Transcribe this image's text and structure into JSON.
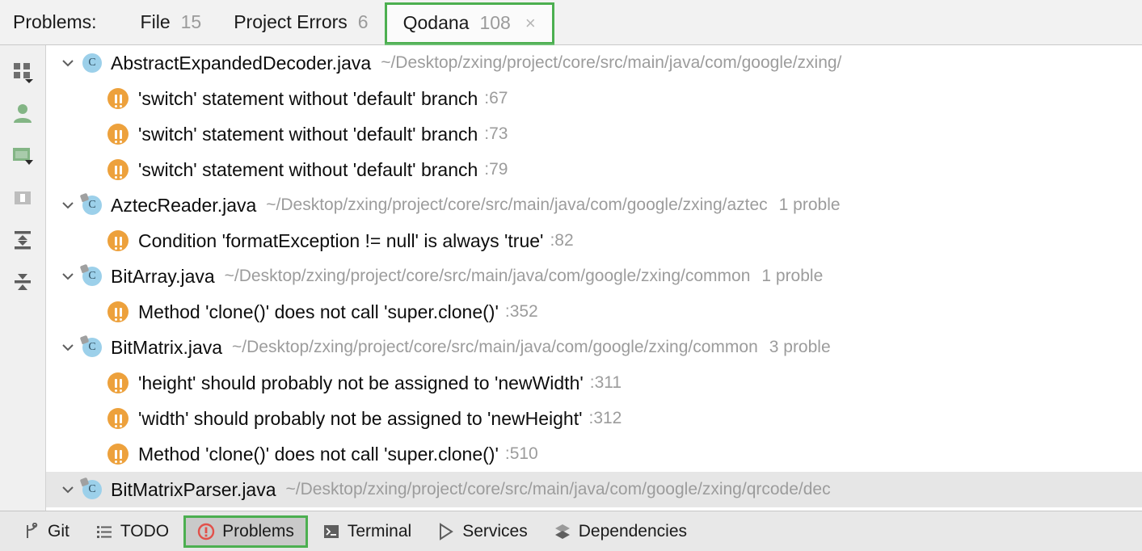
{
  "tabbar": {
    "title": "Problems:",
    "tabs": [
      {
        "label": "File",
        "count": "15",
        "icon": "",
        "selected": false
      },
      {
        "label": "Project Errors",
        "count": "6",
        "icon": "",
        "selected": false
      },
      {
        "label": "Qodana",
        "count": "108",
        "close": "×",
        "selected": true
      }
    ]
  },
  "sidebar": {
    "items": [
      {
        "name": "group-by-icon",
        "tooltip": "Group By"
      },
      {
        "name": "user-icon",
        "tooltip": "Show Author"
      },
      {
        "name": "preview-panel-icon",
        "tooltip": "Preview"
      },
      {
        "name": "split-panel-icon",
        "tooltip": "Split Mode"
      },
      {
        "name": "expand-all-icon",
        "tooltip": "Expand All"
      },
      {
        "name": "collapse-all-icon",
        "tooltip": "Collapse All"
      }
    ]
  },
  "tree": {
    "rows": [
      {
        "kind": "file",
        "name": "AbstractExpandedDecoder.java",
        "path": "~/Desktop/zxing/project/core/src/main/java/com/google/zxing/",
        "count": "",
        "modifier": false,
        "hovered": false
      },
      {
        "kind": "problem",
        "text": "'switch' statement without 'default' branch",
        "line": ":67",
        "hovered": false
      },
      {
        "kind": "problem",
        "text": "'switch' statement without 'default' branch",
        "line": ":73",
        "hovered": false
      },
      {
        "kind": "problem",
        "text": "'switch' statement without 'default' branch",
        "line": ":79",
        "hovered": false
      },
      {
        "kind": "file",
        "name": "AztecReader.java",
        "path": "~/Desktop/zxing/project/core/src/main/java/com/google/zxing/aztec",
        "count": "1 proble",
        "modifier": true,
        "hovered": false
      },
      {
        "kind": "problem",
        "text": "Condition 'formatException != null' is always 'true'",
        "line": ":82",
        "hovered": false
      },
      {
        "kind": "file",
        "name": "BitArray.java",
        "path": "~/Desktop/zxing/project/core/src/main/java/com/google/zxing/common",
        "count": "1 proble",
        "modifier": true,
        "hovered": false
      },
      {
        "kind": "problem",
        "text": "Method 'clone()' does not call 'super.clone()'",
        "line": ":352",
        "hovered": false
      },
      {
        "kind": "file",
        "name": "BitMatrix.java",
        "path": "~/Desktop/zxing/project/core/src/main/java/com/google/zxing/common",
        "count": "3 proble",
        "modifier": true,
        "hovered": false
      },
      {
        "kind": "problem",
        "text": "'height' should probably not be assigned to 'newWidth'",
        "line": ":311",
        "hovered": false
      },
      {
        "kind": "problem",
        "text": "'width' should probably not be assigned to 'newHeight'",
        "line": ":312",
        "hovered": false
      },
      {
        "kind": "problem",
        "text": "Method 'clone()' does not call 'super.clone()'",
        "line": ":510",
        "hovered": false
      },
      {
        "kind": "file",
        "name": "BitMatrixParser.java",
        "path": "~/Desktop/zxing/project/core/src/main/java/com/google/zxing/qrcode/dec",
        "count": "",
        "modifier": true,
        "hovered": true
      }
    ],
    "file_icon_letter": "C"
  },
  "statusbar": {
    "items": [
      {
        "label": "Git",
        "icon": "git-branch-icon",
        "active": false
      },
      {
        "label": "TODO",
        "icon": "todo-list-icon",
        "active": false
      },
      {
        "label": "Problems",
        "icon": "problems-error-icon",
        "active": true
      },
      {
        "label": "Terminal",
        "icon": "terminal-icon",
        "active": false
      },
      {
        "label": "Services",
        "icon": "services-run-icon",
        "active": false
      },
      {
        "label": "Dependencies",
        "icon": "dependencies-layers-icon",
        "active": false
      }
    ]
  },
  "colors": {
    "accent_green": "#4caf50",
    "warning_orange": "#eda13c",
    "error_red": "#e2504a",
    "file_icon_blue": "#9cd0ea",
    "muted_text": "#9c9c9c"
  }
}
